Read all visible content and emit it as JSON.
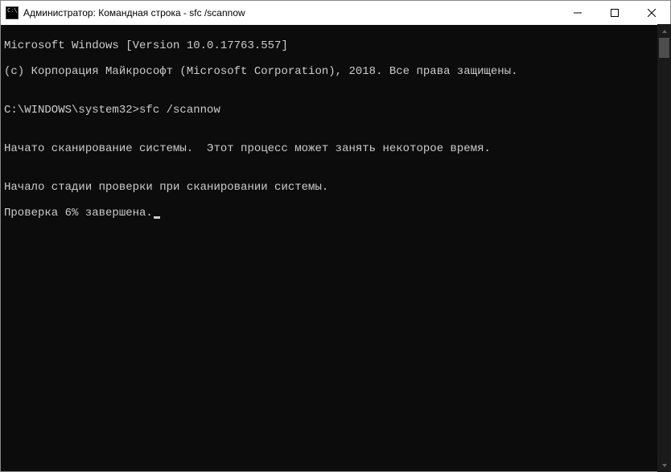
{
  "titlebar": {
    "title": "Администратор: Командная строка - sfc  /scannow"
  },
  "console": {
    "line1": "Microsoft Windows [Version 10.0.17763.557]",
    "line2": "(c) Корпорация Майкрософт (Microsoft Corporation), 2018. Все права защищены.",
    "blank1": "",
    "prompt_line": "C:\\WINDOWS\\system32>sfc /scannow",
    "blank2": "",
    "scan_started": "Начато сканирование системы.  Этот процесс может занять некоторое время.",
    "blank3": "",
    "stage_start": "Начало стадии проверки при сканировании системы.",
    "progress": "Проверка 6% завершена."
  }
}
